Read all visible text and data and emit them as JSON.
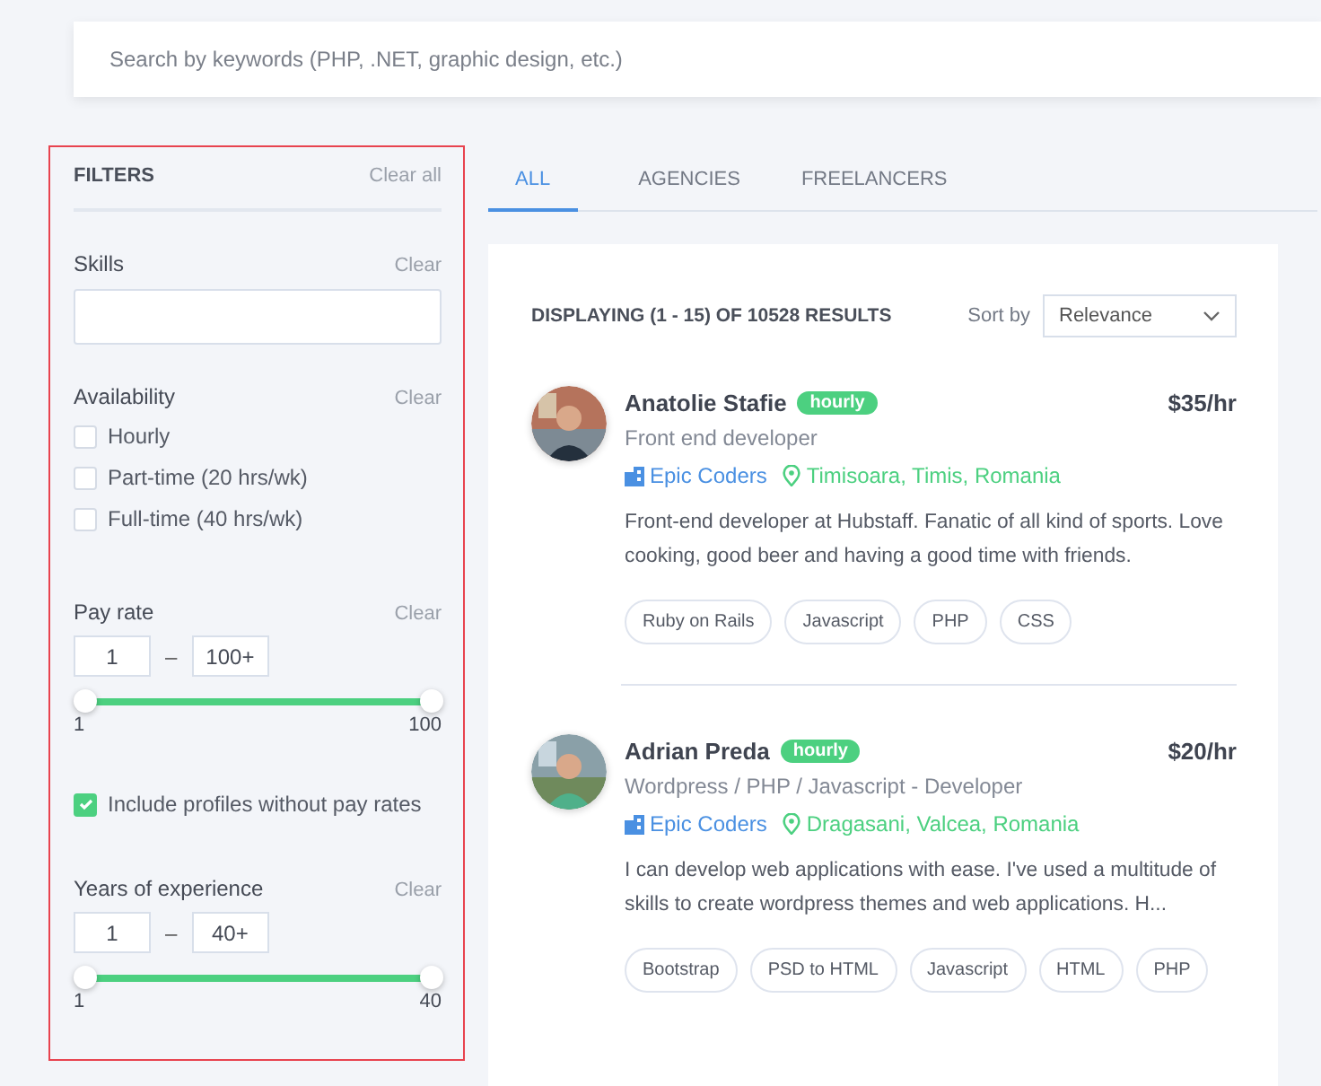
{
  "search": {
    "placeholder": "Search by keywords (PHP, .NET, graphic design, etc.)"
  },
  "filters": {
    "title": "FILTERS",
    "clear_all": "Clear all",
    "skills": {
      "label": "Skills",
      "clear": "Clear"
    },
    "availability": {
      "label": "Availability",
      "clear": "Clear",
      "options": [
        {
          "label": "Hourly",
          "checked": false
        },
        {
          "label": "Part-time (20 hrs/wk)",
          "checked": false
        },
        {
          "label": "Full-time (40 hrs/wk)",
          "checked": false
        }
      ]
    },
    "pay_rate": {
      "label": "Pay rate",
      "clear": "Clear",
      "min": "1",
      "max": "100+",
      "dash": "–",
      "level": 1,
      "scale_min": "1",
      "scale_max": "100"
    },
    "include_without_rates": {
      "label": "Include profiles without pay rates",
      "checked": true
    },
    "experience": {
      "label": "Years of experience",
      "clear": "Clear",
      "min": "1",
      "max": "40+",
      "dash": "–",
      "level": 1,
      "scale_min": "1",
      "scale_max": "40"
    }
  },
  "tabs": [
    {
      "label": "ALL",
      "selected": true
    },
    {
      "label": "AGENCIES",
      "selected": false
    },
    {
      "label": "FREELANCERS",
      "selected": false
    }
  ],
  "results": {
    "summary": "DISPLAYING (1 - 15) OF 10528 RESULTS",
    "sort_label": "Sort by",
    "sort_value": "Relevance",
    "profiles": [
      {
        "name": "Anatolie Stafie",
        "badge": "hourly",
        "rate": "$35/hr",
        "title": "Front end developer",
        "company": "Epic Coders",
        "location": "Timisoara, Timis, Romania",
        "bio": "Front-end developer at Hubstaff. Fanatic of all kind of sports. Love cooking, good beer and having a good time with friends.",
        "skills": [
          "Ruby on Rails",
          "Javascript",
          "PHP",
          "CSS"
        ]
      },
      {
        "name": "Adrian Preda",
        "badge": "hourly",
        "rate": "$20/hr",
        "title": "Wordpress / PHP / Javascript - Developer",
        "company": "Epic Coders",
        "location": "Dragasani, Valcea, Romania",
        "bio": "I can develop web applications with ease. I've used a multitude of skills to create wordpress themes and web applications. H...",
        "skills": [
          "Bootstrap",
          "PSD to HTML",
          "Javascript",
          "HTML",
          "PHP"
        ]
      }
    ]
  }
}
